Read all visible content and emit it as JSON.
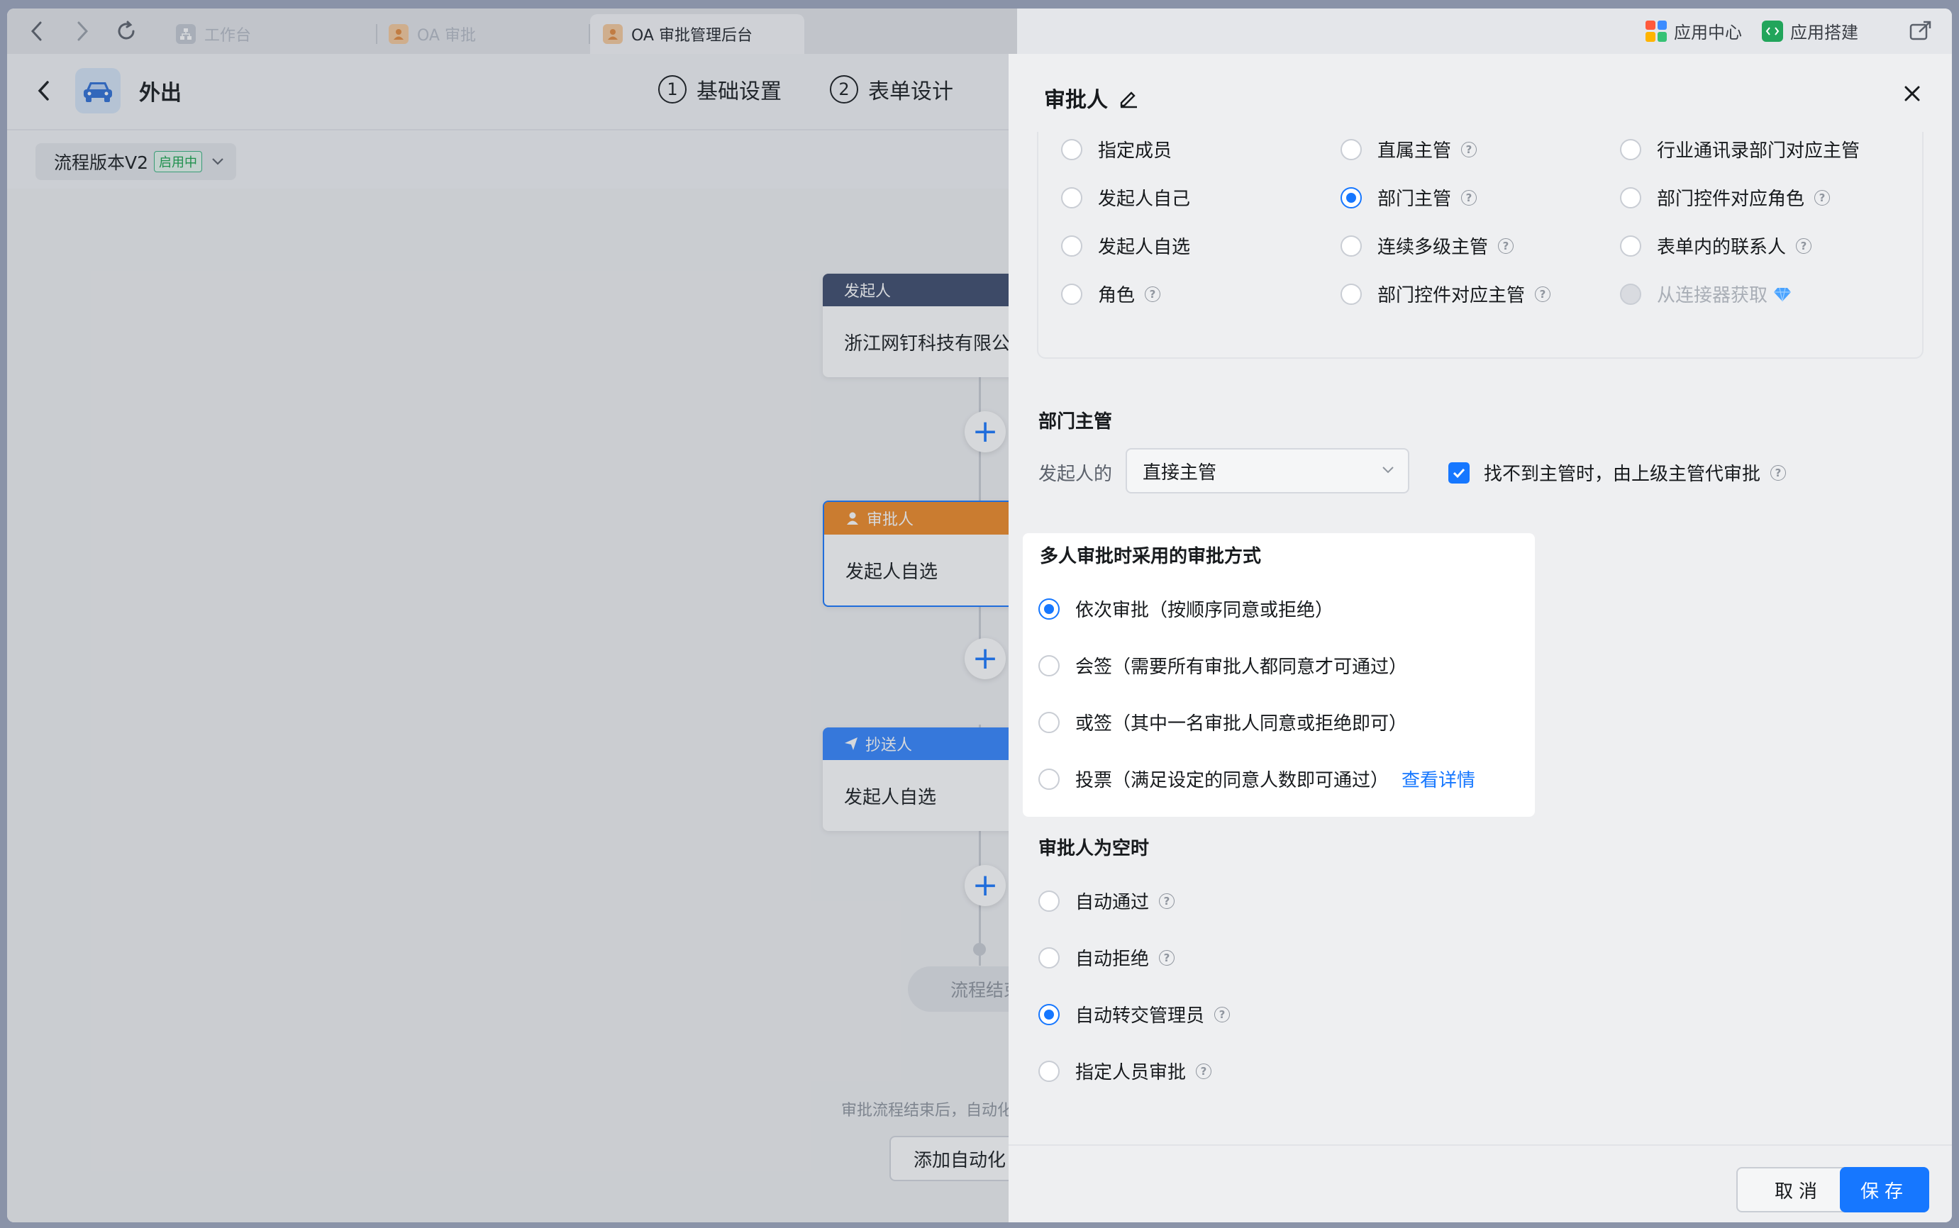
{
  "browser": {
    "tabs": [
      {
        "label": "工作台",
        "active": false
      },
      {
        "label": "OA 审批",
        "active": false
      },
      {
        "label": "OA 审批管理后台",
        "active": true
      }
    ],
    "app_center_label": "应用中心",
    "app_builder_label": "应用搭建"
  },
  "header": {
    "app_title": "外出",
    "steps": [
      {
        "num": "1",
        "label": "基础设置"
      },
      {
        "num": "2",
        "label": "表单设计"
      }
    ]
  },
  "version": {
    "label": "流程版本V2",
    "badge": "启用中"
  },
  "flow": {
    "nodes": [
      {
        "header": "发起人",
        "body": "浙江网钉科技有限公司"
      },
      {
        "header": "审批人",
        "body": "发起人自选"
      },
      {
        "header": "抄送人",
        "body": "发起人自选"
      }
    ],
    "end_label": "流程结束",
    "end_tip": "审批流程结束后，自动化",
    "add_automation": "添加自动化"
  },
  "drawer": {
    "title": "审批人",
    "approver_types": [
      {
        "label": "指定成员",
        "selected": false,
        "help": false
      },
      {
        "label": "直属主管",
        "selected": false,
        "help": true
      },
      {
        "label": "行业通讯录部门对应主管",
        "selected": false,
        "help": false
      },
      {
        "label": "发起人自己",
        "selected": false,
        "help": false
      },
      {
        "label": "部门主管",
        "selected": true,
        "help": true
      },
      {
        "label": "部门控件对应角色",
        "selected": false,
        "help": true
      },
      {
        "label": "发起人自选",
        "selected": false,
        "help": false
      },
      {
        "label": "连续多级主管",
        "selected": false,
        "help": true
      },
      {
        "label": "表单内的联系人",
        "selected": false,
        "help": true
      },
      {
        "label": "角色",
        "selected": false,
        "help": true
      },
      {
        "label": "部门控件对应主管",
        "selected": false,
        "help": true
      },
      {
        "label": "从连接器获取",
        "selected": false,
        "help": false,
        "disabled": true
      }
    ],
    "dept_manager": {
      "section_title": "部门主管",
      "prefix_label": "发起人的",
      "select_value": "直接主管",
      "checkbox_label": "找不到主管时，由上级主管代审批",
      "checked": true
    },
    "multi_approve": {
      "section_title": "多人审批时采用的审批方式",
      "options": [
        {
          "label": "依次审批（按顺序同意或拒绝）",
          "selected": true
        },
        {
          "label": "会签（需要所有审批人都同意才可通过）",
          "selected": false
        },
        {
          "label": "或签（其中一名审批人同意或拒绝即可）",
          "selected": false
        },
        {
          "label": "投票（满足设定的同意人数即可通过）",
          "selected": false,
          "link": "查看详情"
        }
      ]
    },
    "empty_approver": {
      "section_title": "审批人为空时",
      "options": [
        {
          "label": "自动通过",
          "selected": false
        },
        {
          "label": "自动拒绝",
          "selected": false
        },
        {
          "label": "自动转交管理员",
          "selected": true
        },
        {
          "label": "指定人员审批",
          "selected": false
        }
      ]
    },
    "cancel_label": "取消",
    "save_label": "保存"
  },
  "colors": {
    "primary": "#1677ff",
    "initiator_header": "#3b4a6b",
    "approver_header": "#f08a24",
    "cc_header": "#3385ff"
  }
}
